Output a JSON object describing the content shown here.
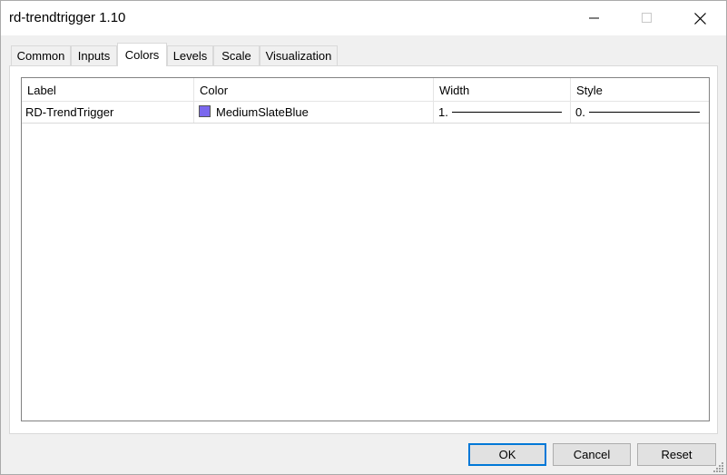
{
  "window": {
    "title": "rd-trendtrigger 1.10"
  },
  "tabs": [
    {
      "label": "Common",
      "active": false
    },
    {
      "label": "Inputs",
      "active": false
    },
    {
      "label": "Colors",
      "active": true
    },
    {
      "label": "Levels",
      "active": false
    },
    {
      "label": "Scale",
      "active": false
    },
    {
      "label": "Visualization",
      "active": false
    }
  ],
  "table": {
    "columns": [
      "Label",
      "Color",
      "Width",
      "Style"
    ],
    "rows": [
      {
        "label": "RD-TrendTrigger",
        "color_name": "MediumSlateBlue",
        "color_hex": "#7b68ee",
        "width": "1.",
        "style": "0."
      }
    ]
  },
  "buttons": {
    "ok": "OK",
    "cancel": "Cancel",
    "reset": "Reset"
  },
  "colors": {
    "accent": "#0078d7",
    "swatch": "#7b68ee"
  }
}
